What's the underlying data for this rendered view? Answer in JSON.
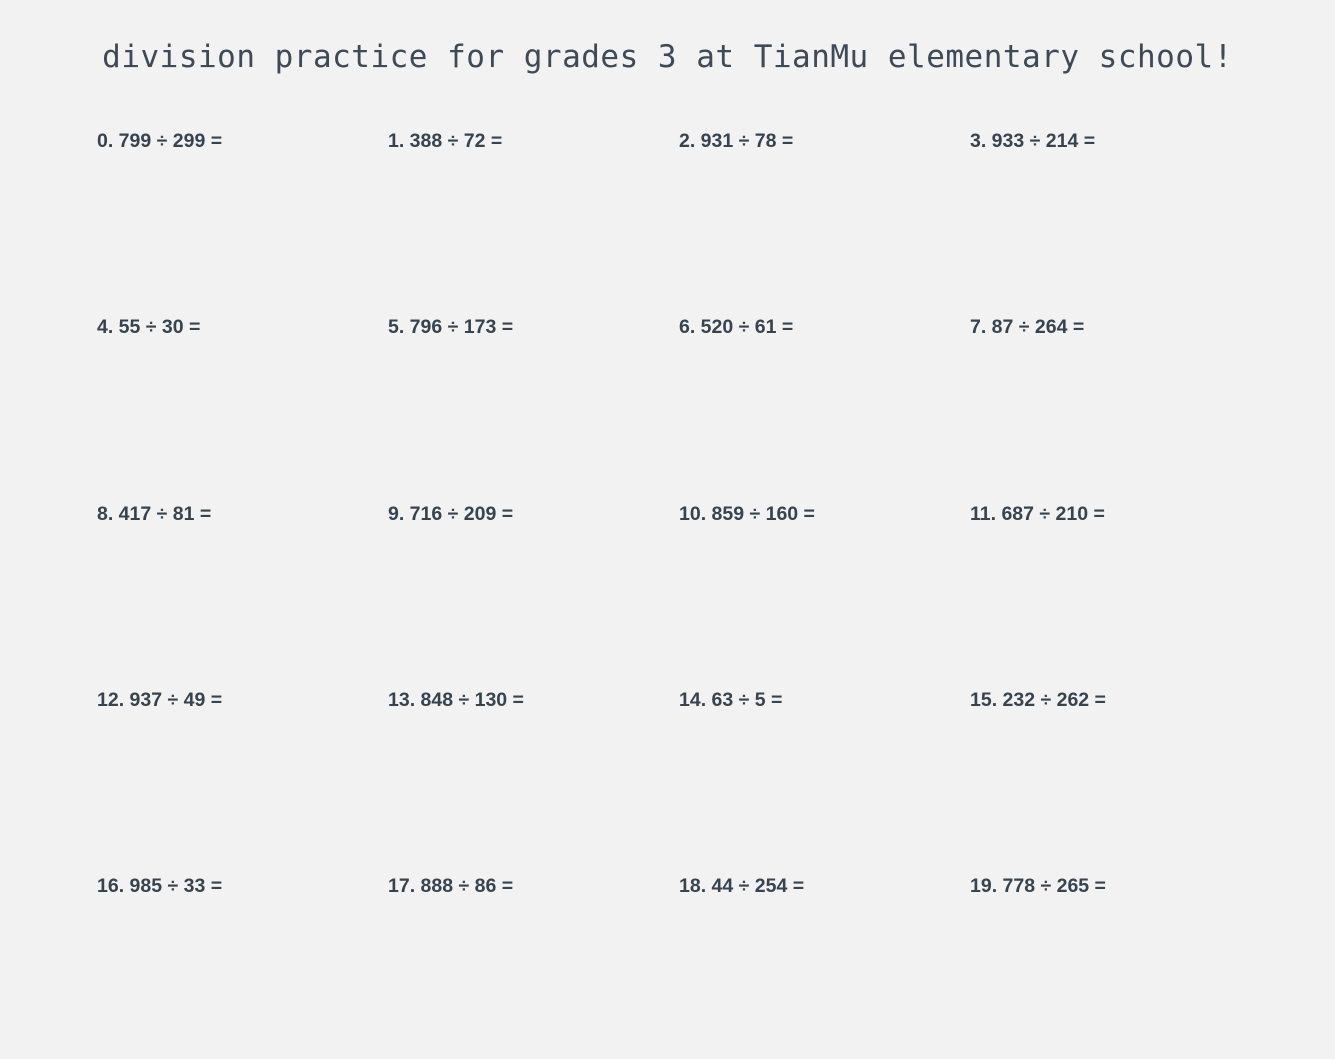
{
  "worksheet": {
    "title": "division practice for grades 3 at TianMu elementary school!",
    "problems": [
      "0. 799 ÷ 299 =",
      "1. 388 ÷ 72 =",
      "2. 931 ÷ 78 =",
      "3. 933 ÷ 214 =",
      "4. 55 ÷ 30 =",
      "5. 796 ÷ 173 =",
      "6. 520 ÷ 61 =",
      "7. 87 ÷ 264 =",
      "8. 417 ÷ 81 =",
      "9. 716 ÷ 209 =",
      "10. 859 ÷ 160 =",
      "11. 687 ÷ 210 =",
      "12. 937 ÷ 49 =",
      "13. 848 ÷ 130 =",
      "14. 63 ÷ 5 =",
      "15. 232 ÷ 262 =",
      "16. 985 ÷ 33 =",
      "17. 888 ÷ 86 =",
      "18. 44 ÷ 254 =",
      "19. 778 ÷ 265 ="
    ]
  }
}
